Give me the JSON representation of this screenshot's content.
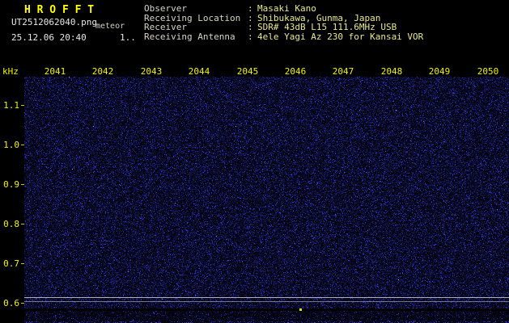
{
  "header": {
    "title": "H R O F F T",
    "filename": "UT2512062040.png",
    "mode_label": "meteor",
    "datetime": "25.12.06 20:40",
    "counter": "1..",
    "separator": ":",
    "info_rows": [
      {
        "label": "Observer",
        "value": "Masaki Kano"
      },
      {
        "label": "Receiving Location",
        "value": "Shibukawa, Gunma, Japan"
      },
      {
        "label": "Receiver",
        "value": "SDR# 43dB L15 111.6MHz USB"
      },
      {
        "label": "Receiving Antenna",
        "value": "4ele Yagi Az 230 for Kansai VOR"
      }
    ]
  },
  "colors": {
    "background": "#000000",
    "title_yellow": "#ffff00",
    "axis_yellow": "#f2f200",
    "header_label": "#d6d6c6",
    "header_value": "#eaea88",
    "white_text": "#e8e8e8",
    "noise_blue": "#2222cc",
    "reference_line": "#cdcdd8"
  },
  "chart_data": {
    "type": "heatmap",
    "subtype": "radio-meteor-spectrogram",
    "x_ticks": [
      "2041",
      "2042",
      "2043",
      "2044",
      "2045",
      "2046",
      "2047",
      "2048",
      "2049",
      "2050"
    ],
    "x_unit": "time (UT hhmm)",
    "x_range": [
      "2040",
      "2050"
    ],
    "y_ticks": [
      "1.1",
      "1.0",
      "0.9",
      "0.8",
      "0.7",
      "0.6"
    ],
    "y_unit": "kHz",
    "y_range": [
      0.6,
      1.1
    ],
    "grid": false,
    "legend": "none",
    "content_summary": "uniform dark-blue background noise across the whole 10-minute spectrogram, no meteor echo traces",
    "reference_lines_khz": [
      0.6,
      0.59
    ],
    "bottom_strip": "signal-level lane along bottom edge with sparse blue noise dots"
  }
}
